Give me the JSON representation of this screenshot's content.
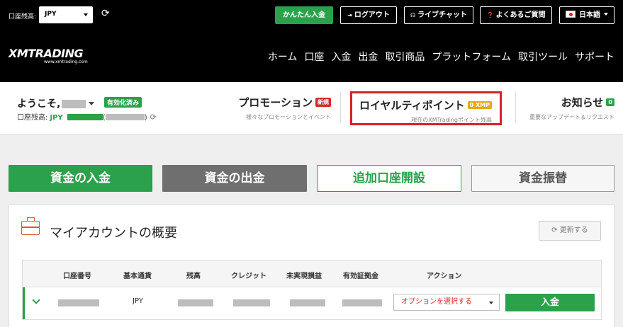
{
  "topbar": {
    "balance_label": "口座残高:",
    "account_select": "JPY",
    "quick_deposit": "かんたん入金",
    "logout": "ログアウト",
    "live_chat": "ライブチャット",
    "faq": "よくあるご質問",
    "language": "日本語"
  },
  "logo": {
    "name": "XMTRADING",
    "url": "www.xmtrading.com"
  },
  "nav": {
    "items": [
      "ホーム",
      "口座",
      "入金",
      "出金",
      "取引商品",
      "プラットフォーム",
      "取引ツール",
      "サポート"
    ]
  },
  "info": {
    "welcome": "ようこそ,",
    "verified": "有効化済み",
    "balance_label": "口座残高:",
    "currency": "JPY",
    "promo_title": "プロモーション",
    "promo_badge": "新規",
    "promo_sub": "様々なプロモーションとイベント",
    "royalty_title": "ロイヤルティポイント",
    "royalty_badge": "0 XMP",
    "royalty_sub": "現在のXMTradingポイント残高",
    "notice_title": "お知らせ",
    "notice_badge": "0",
    "notice_sub": "重要なアップデート＆リクエスト"
  },
  "actions": {
    "deposit": "資金の入金",
    "withdraw": "資金の出金",
    "open_account": "追加口座開設",
    "transfer": "資金振替"
  },
  "panel": {
    "title": "マイアカウントの概要",
    "refresh": "更新する",
    "columns": [
      "口座番号",
      "基本通貨",
      "残高",
      "クレジット",
      "未実現損益",
      "有効証拠金",
      "アクション"
    ],
    "row": {
      "currency": "JPY",
      "option_select": "オプションを選択する",
      "deposit": "入金"
    }
  },
  "colors": {
    "brand_green": "#2aa14a",
    "highlight_red": "#d4212a",
    "badge_orange": "#e6a817"
  }
}
